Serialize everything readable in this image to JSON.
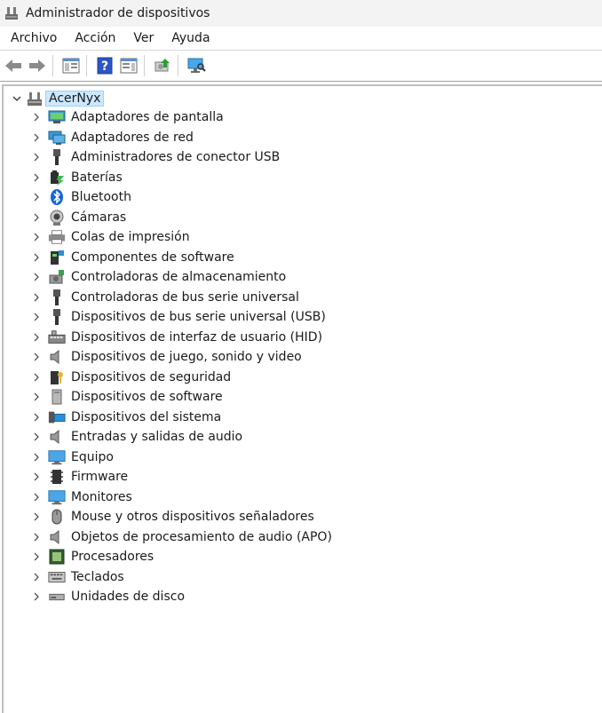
{
  "window": {
    "title": "Administrador de dispositivos"
  },
  "menu": [
    "Archivo",
    "Acción",
    "Ver",
    "Ayuda"
  ],
  "toolbar": {
    "buttons": [
      "back-icon",
      "forward-icon",
      "show-hide-tree-icon",
      "help-icon",
      "properties-icon",
      "update-driver-icon",
      "scan-hardware-icon"
    ]
  },
  "tree": {
    "root": "AcerNyx",
    "categories": [
      {
        "label": "Adaptadores de pantalla",
        "icon": "display-adapter-icon"
      },
      {
        "label": "Adaptadores de red",
        "icon": "network-adapter-icon"
      },
      {
        "label": "Administradores de conector USB",
        "icon": "usb-connector-icon"
      },
      {
        "label": "Baterías",
        "icon": "battery-icon"
      },
      {
        "label": "Bluetooth",
        "icon": "bluetooth-icon"
      },
      {
        "label": "Cámaras",
        "icon": "camera-icon"
      },
      {
        "label": "Colas de impresión",
        "icon": "printer-icon"
      },
      {
        "label": "Componentes de software",
        "icon": "software-component-icon"
      },
      {
        "label": "Controladoras de almacenamiento",
        "icon": "storage-controller-icon"
      },
      {
        "label": "Controladoras de bus serie universal",
        "icon": "usb-controller-icon"
      },
      {
        "label": "Dispositivos de bus serie universal (USB)",
        "icon": "usb-device-icon"
      },
      {
        "label": "Dispositivos de interfaz de usuario (HID)",
        "icon": "hid-icon"
      },
      {
        "label": "Dispositivos de juego, sonido y video",
        "icon": "speaker-icon"
      },
      {
        "label": "Dispositivos de seguridad",
        "icon": "security-device-icon"
      },
      {
        "label": "Dispositivos de software",
        "icon": "software-device-icon"
      },
      {
        "label": "Dispositivos del sistema",
        "icon": "system-device-icon"
      },
      {
        "label": "Entradas y salidas de audio",
        "icon": "audio-io-icon"
      },
      {
        "label": "Equipo",
        "icon": "computer-icon"
      },
      {
        "label": "Firmware",
        "icon": "firmware-chip-icon"
      },
      {
        "label": "Monitores",
        "icon": "monitor-icon"
      },
      {
        "label": "Mouse y otros dispositivos señaladores",
        "icon": "mouse-icon"
      },
      {
        "label": "Objetos de procesamiento de audio (APO)",
        "icon": "audio-apo-icon"
      },
      {
        "label": "Procesadores",
        "icon": "processor-icon"
      },
      {
        "label": "Teclados",
        "icon": "keyboard-icon"
      },
      {
        "label": "Unidades de disco",
        "icon": "disk-drive-icon"
      }
    ]
  }
}
